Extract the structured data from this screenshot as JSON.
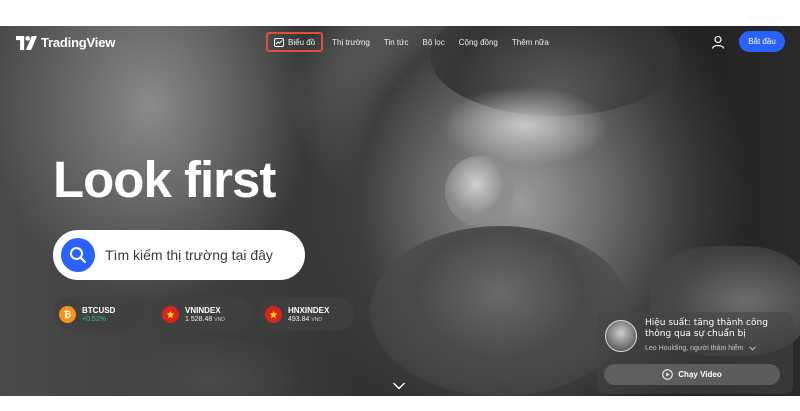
{
  "header": {
    "brand": "TradingView",
    "nav": [
      {
        "label": "Biểu đồ",
        "icon": "chart-icon",
        "active": true
      },
      {
        "label": "Thị trường"
      },
      {
        "label": "Tin tức"
      },
      {
        "label": "Bộ lọc"
      },
      {
        "label": "Cộng đồng"
      },
      {
        "label": "Thêm nữa"
      }
    ],
    "user_icon": "user-icon",
    "cta": "Bắt đầu"
  },
  "hero": {
    "title": "Look first",
    "search_placeholder": "Tìm kiếm thị trường tại đây"
  },
  "tickers": [
    {
      "symbol": "BTCUSD",
      "value": "+0.52%",
      "unit": "",
      "icon": "bitcoin-icon",
      "icon_color": "#f7931a"
    },
    {
      "symbol": "VNINDEX",
      "value": "1 528.48",
      "unit": "VND",
      "icon": "vietnam-flag-icon",
      "icon_color": "#da251d"
    },
    {
      "symbol": "HNXINDEX",
      "value": "493.84",
      "unit": "VND",
      "icon": "vietnam-flag-icon",
      "icon_color": "#da251d"
    }
  ],
  "video": {
    "title": "Hiệu suất: tăng thành công thông qua sự chuẩn bị",
    "author": "Leo Houlding, người thám hiểm",
    "button": "Chạy Video"
  },
  "colors": {
    "accent": "#2962ff",
    "highlight_border": "#e04e3c",
    "positive": "#26c08b"
  }
}
